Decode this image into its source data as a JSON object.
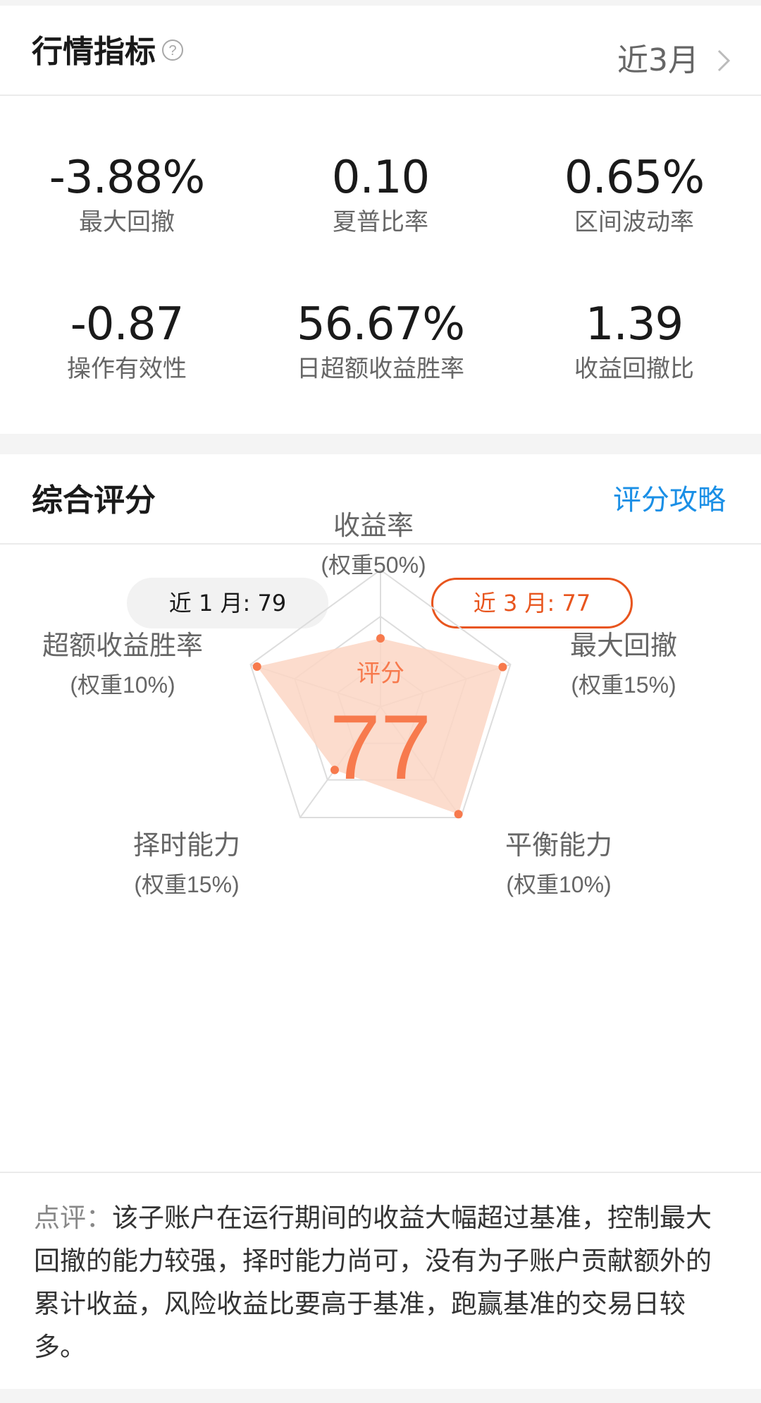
{
  "market": {
    "title": "行情指标",
    "period": "近3月",
    "metrics": [
      {
        "value": "-3.88%",
        "label": "最大回撤"
      },
      {
        "value": "0.10",
        "label": "夏普比率"
      },
      {
        "value": "0.65%",
        "label": "区间波动率"
      },
      {
        "value": "-0.87",
        "label": "操作有效性"
      },
      {
        "value": "56.67%",
        "label": "日超额收益胜率"
      },
      {
        "value": "1.39",
        "label": "收益回撤比"
      }
    ]
  },
  "score": {
    "title": "综合评分",
    "guide_link": "评分攻略",
    "tabs": [
      {
        "label": "近 1 月: 79"
      },
      {
        "label": "近 3 月: 77"
      }
    ],
    "center_label": "评分",
    "center_value": "77",
    "accent_color": "#f77a4d",
    "fill_color": "#fcd6c4",
    "dimensions": [
      {
        "name": "收益率",
        "weight": "(权重50%)",
        "score": 0.5
      },
      {
        "name": "最大回撤",
        "weight": "(权重15%)",
        "score": 0.94
      },
      {
        "name": "平衡能力",
        "weight": "(权重10%)",
        "score": 0.97
      },
      {
        "name": "择时能力",
        "weight": "(权重15%)",
        "score": 0.57
      },
      {
        "name": "超额收益胜率",
        "weight": "(权重10%)",
        "score": 0.95
      }
    ]
  },
  "comment": {
    "prefix": "点评：",
    "text": "该子账户在运行期间的收益大幅超过基准，控制最大回撤的能力较强，择时能力尚可，没有为子账户贡献额外的累计收益，风险收益比要高于基准，跑赢基准的交易日较多。"
  }
}
